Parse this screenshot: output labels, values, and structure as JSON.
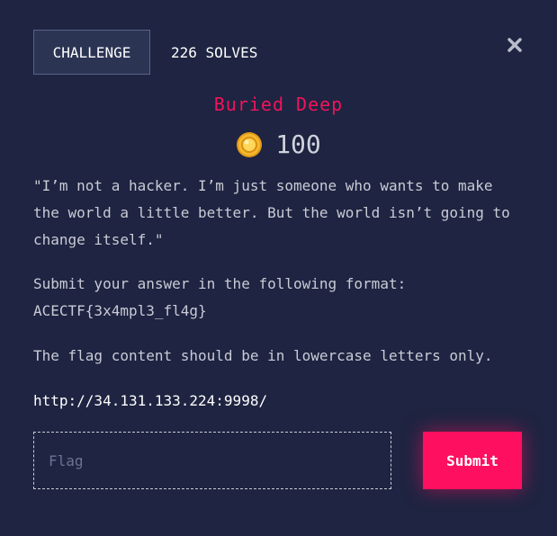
{
  "tabs": {
    "challenge_label": "CHALLENGE",
    "solves_label": "226 SOLVES"
  },
  "challenge": {
    "title": "Buried Deep",
    "points": "100",
    "description": [
      "\"I’m not a hacker. I’m just someone who wants to make the world a little better. But the world isn’t going to change itself.\"",
      "Submit your answer in the following format: ACECTF{3x4mpl3_fl4g}",
      "The flag content should be in lowercase letters only.",
      "http://34.131.133.224:9998/"
    ]
  },
  "form": {
    "flag_value": "",
    "flag_placeholder": "Flag",
    "submit_label": "Submit"
  },
  "icons": {
    "close": "close-icon",
    "coin": "coin-icon"
  },
  "colors": {
    "background": "#1e2441",
    "accent": "#ff0f5f",
    "title": "#f0145a",
    "coin": "#f5b82e"
  }
}
